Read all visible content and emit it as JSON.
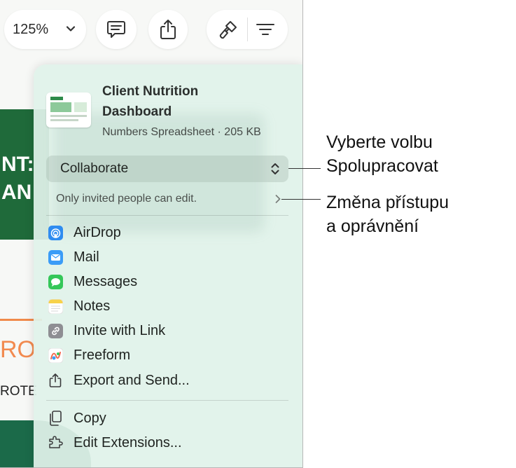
{
  "toolbar": {
    "zoom": "125%"
  },
  "background": {
    "green_line1": "NT:",
    "green_line2": "AN",
    "orange_text": "RO",
    "small_text": "ROTE"
  },
  "share": {
    "doc_title_line1": "Client Nutrition",
    "doc_title_line2": "Dashboard",
    "doc_meta": "Numbers Spreadsheet · 205 KB",
    "collaborate_label": "Collaborate",
    "access_text": "Only invited people can edit.",
    "items": [
      {
        "label": "AirDrop",
        "icon": "airdrop-icon",
        "color": "#2f8cf0"
      },
      {
        "label": "Mail",
        "icon": "mail-icon",
        "color": "#3b9cf7"
      },
      {
        "label": "Messages",
        "icon": "messages-icon",
        "color": "#34c759"
      },
      {
        "label": "Notes",
        "icon": "notes-icon",
        "color": "#f7d24a"
      },
      {
        "label": "Invite with Link",
        "icon": "link-icon",
        "color": "#8e8e93"
      },
      {
        "label": "Freeform",
        "icon": "freeform-icon",
        "color": "#f06a4f"
      },
      {
        "label": "Export and Send...",
        "icon": "export-icon",
        "color": "#3a3a3c"
      }
    ],
    "bottom_items": [
      {
        "label": "Copy",
        "icon": "copy-icon"
      },
      {
        "label": "Edit Extensions...",
        "icon": "extensions-icon"
      }
    ]
  },
  "callouts": {
    "collaborate_line1": "Vyberte volbu",
    "collaborate_line2": "Spolupracovat",
    "access_line1": "Změna přístupu",
    "access_line2": "a oprávnění"
  }
}
